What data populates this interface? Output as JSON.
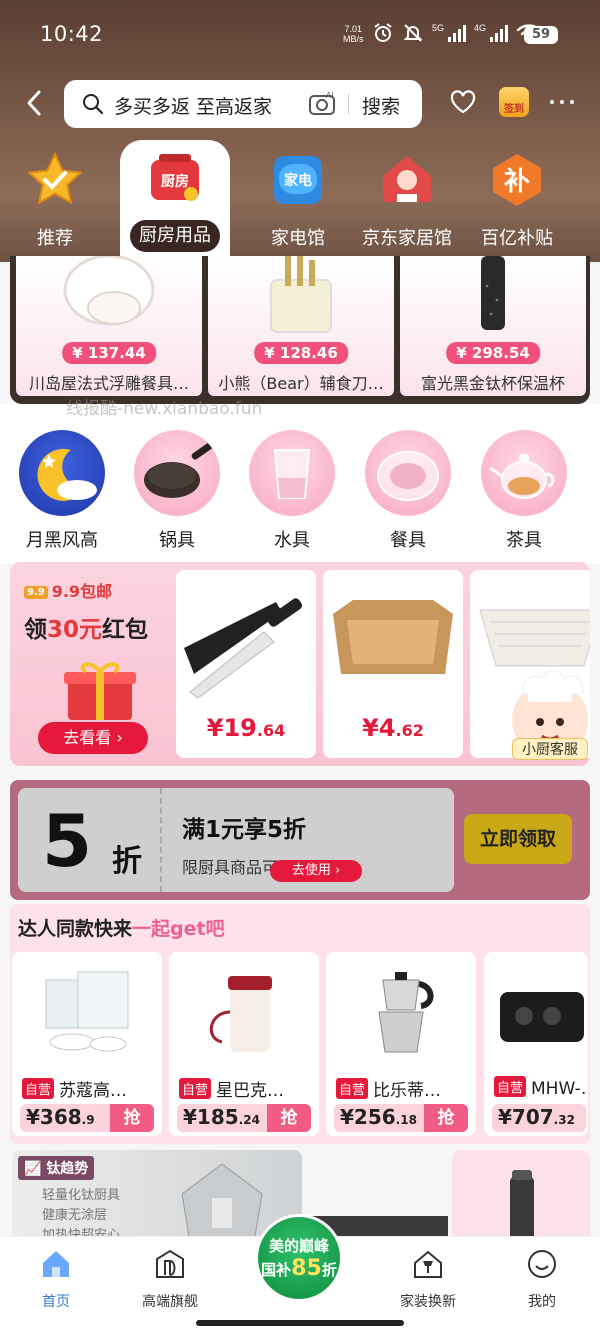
{
  "status_bar": {
    "time": "10:42",
    "net_speed_value": "7.01",
    "net_speed_unit": "MB/s",
    "net1": "5G",
    "net2": "4G",
    "battery": "59"
  },
  "search": {
    "query": "多买多返  至高返家",
    "button": "搜索",
    "ai_label": "AI",
    "checkin_label": "签到"
  },
  "categories": [
    {
      "label": "推荐",
      "icon": "star-check-icon"
    },
    {
      "label": "厨房用品",
      "icon": "kitchen-icon",
      "icon_text": "厨房",
      "active": true
    },
    {
      "label": "家电馆",
      "icon": "appliance-icon",
      "icon_text": "家电"
    },
    {
      "label": "京东家居馆",
      "icon": "home-decor-icon"
    },
    {
      "label": "百亿补贴",
      "icon": "subsidy-icon",
      "icon_text": "补"
    }
  ],
  "top_products": [
    {
      "price": "¥ 137.44",
      "name": "川岛屋法式浮雕餐具…"
    },
    {
      "price": "¥ 128.46",
      "name": "小熊（Bear）辅食刀…"
    },
    {
      "price": "¥ 298.54",
      "name": "富光黑金钛杯保温杯"
    }
  ],
  "watermark": "线报酷-new.xianbao.fun",
  "circle_categories": [
    {
      "label": "月黑风高",
      "icon": "moon-icon"
    },
    {
      "label": "锅具",
      "icon": "pan-icon"
    },
    {
      "label": "水具",
      "icon": "glass-icon"
    },
    {
      "label": "餐具",
      "icon": "plate-icon"
    },
    {
      "label": "茶具",
      "icon": "teapot-icon"
    }
  ],
  "promo": {
    "badge_icon_text": "9.9",
    "badge": "9.9包邮",
    "title_pre": "领",
    "title_red": "30元",
    "title_post": "红包",
    "button": "去看看",
    "deals": [
      {
        "price_int": "¥19",
        "price_dec": ".64",
        "icon": "knife-icon"
      },
      {
        "price_int": "¥4",
        "price_dec": ".62",
        "icon": "paper-tray-icon"
      }
    ],
    "assistant": "小厨客服"
  },
  "coupon": {
    "big": "5",
    "unit": "折",
    "title": "满1元享5折",
    "subtitle": "限厨具商品可用",
    "use_button": "去使用",
    "claim_button": "立即领取"
  },
  "talent": {
    "title_black": "达人同款快来",
    "title_pink": "一起get吧",
    "self_label": "自营",
    "grab_label": "抢",
    "items": [
      {
        "name": "苏蔻高…",
        "price_int": "¥368",
        "price_dec": ".9"
      },
      {
        "name": "星巴克…",
        "price_int": "¥185",
        "price_dec": ".24"
      },
      {
        "name": "比乐蒂…",
        "price_int": "¥256",
        "price_dec": ".18"
      },
      {
        "name": "MHW-…",
        "price_int": "¥707",
        "price_dec": ".32"
      }
    ]
  },
  "trend": {
    "tag": "钛趋势",
    "line1": "轻量化钛厨具",
    "line2": "健康无涂层",
    "line3": "加热快超安心"
  },
  "bottom_nav": {
    "items": [
      {
        "label": "首页",
        "icon": "home-icon",
        "active": true
      },
      {
        "label": "高端旗舰",
        "icon": "flagship-icon"
      },
      {
        "label": "家装换新",
        "icon": "house-renew-icon"
      },
      {
        "label": "我的",
        "icon": "profile-icon"
      }
    ],
    "center_line1": "美的巅峰",
    "center_line2_pre": "国补",
    "center_line2_num": "85",
    "center_line2_post": "折"
  },
  "colors": {
    "header_brown": "#7a5a48",
    "accent_red": "#e4193c",
    "pink_bg": "#fde2ea",
    "coupon_frame": "#b56a80",
    "claim_gold": "#c9a717"
  }
}
